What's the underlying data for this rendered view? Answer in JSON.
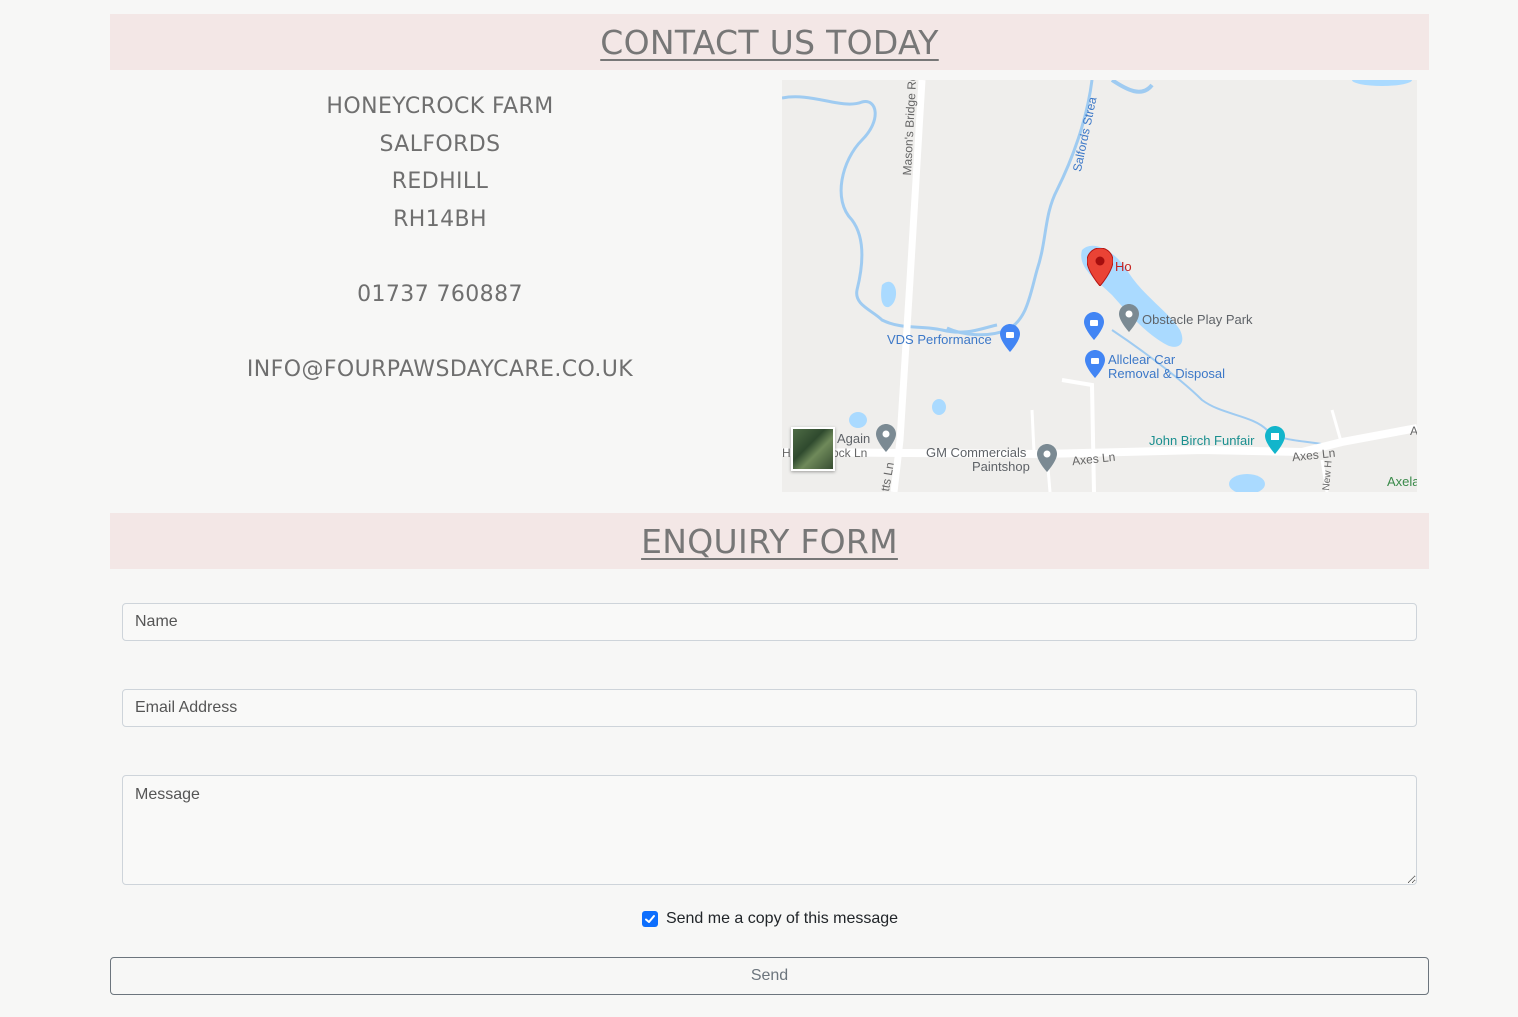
{
  "contact": {
    "heading": "CONTACT US TODAY",
    "address_lines": [
      "HONEYCROCK FARM",
      "SALFORDS",
      "REDHILL",
      "RH14BH"
    ],
    "phone": "01737 760887",
    "email": "INFO@FOURPAWSDAYCARE.CO.UK"
  },
  "map": {
    "labels": {
      "selected_place": "Ho",
      "obstacle_play_park": "Obstacle Play Park",
      "vds_performance": "VDS Performance",
      "allclear_line1": "Allclear Car",
      "allclear_line2": "Removal & Disposal",
      "john_birch": "John Birch Funfair",
      "again": "Again",
      "gm_line1": "GM Commercials",
      "gm_line2": "Paintshop",
      "masons_bridge_rd": "Mason's Bridge Rd",
      "salfords_stream": "Salfords Strea",
      "axes_ln_1": "Axes Ln",
      "axes_ln_2": "Axes Ln",
      "honeycrock_ln_prefix": "H",
      "honeycrock_ln": "ock Ln",
      "its_ln": "tts Ln",
      "axela": "Axela",
      "new_h": "New H",
      "edge_a": "A"
    }
  },
  "enquiry": {
    "heading": "ENQUIRY FORM",
    "name_placeholder": "Name",
    "email_placeholder": "Email Address",
    "message_placeholder": "Message",
    "copy_label": "Send me a copy of this message",
    "copy_checked": true,
    "send_label": "Send"
  },
  "colors": {
    "banner_bg": "#f3e7e6",
    "checkbox_accent": "#0d6efd",
    "pin_red": "#ea4335",
    "water": "#aadaff"
  }
}
